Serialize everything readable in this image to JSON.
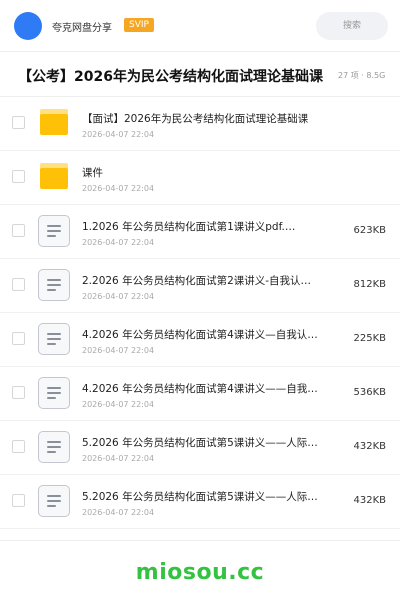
{
  "header": {
    "owner_name": "夸克网盘分享",
    "badge": "SVIP",
    "search_placeholder": "搜索",
    "avatar_color": "#2f7bf5",
    "badge_color": "#f5a623"
  },
  "folder": {
    "title": "【公考】2026年为民公考结构化面试理论基础课",
    "item_count": "27 项",
    "separator": "·",
    "total_size": "8.5G"
  },
  "files": [
    {
      "type": "folder",
      "icon": "folder-icon",
      "name": "【面试】2026年为民公考结构化面试理论基础课",
      "date": "2026-04-07 22:04",
      "size": ""
    },
    {
      "type": "folder",
      "icon": "folder-icon",
      "name": "课件",
      "date": "2026-04-07 22:04",
      "size": ""
    },
    {
      "type": "doc",
      "icon": "document-icon",
      "name": "1.2026 年公务员结构化面试第1课讲义pdf.…",
      "date": "2026-04-07 22:04",
      "size": "623KB"
    },
    {
      "type": "doc",
      "icon": "document-icon",
      "name": "2.2026 年公务员结构化面试第2课讲义-自我认…",
      "date": "2026-04-07 22:04",
      "size": "812KB"
    },
    {
      "type": "doc",
      "icon": "document-icon",
      "name": "4.2026 年公务员结构化面试第4课讲义—自我认…",
      "date": "2026-04-07 22:04",
      "size": "225KB"
    },
    {
      "type": "doc",
      "icon": "document-icon",
      "name": "4.2026 年公务员结构化面试第4课讲义——自我…",
      "date": "2026-04-07 22:04",
      "size": "536KB"
    },
    {
      "type": "doc",
      "icon": "document-icon",
      "name": "5.2026 年公务员结构化面试第5课讲义——人际…",
      "date": "2026-04-07 22:04",
      "size": "432KB"
    },
    {
      "type": "doc",
      "icon": "document-icon",
      "name": "5.2026 年公务员结构化面试第5课讲义——人际…",
      "date": "2026-04-07 22:04",
      "size": "432KB"
    }
  ],
  "footer": {
    "watermark": "miosou.cc",
    "watermark_color": "#34c240"
  }
}
